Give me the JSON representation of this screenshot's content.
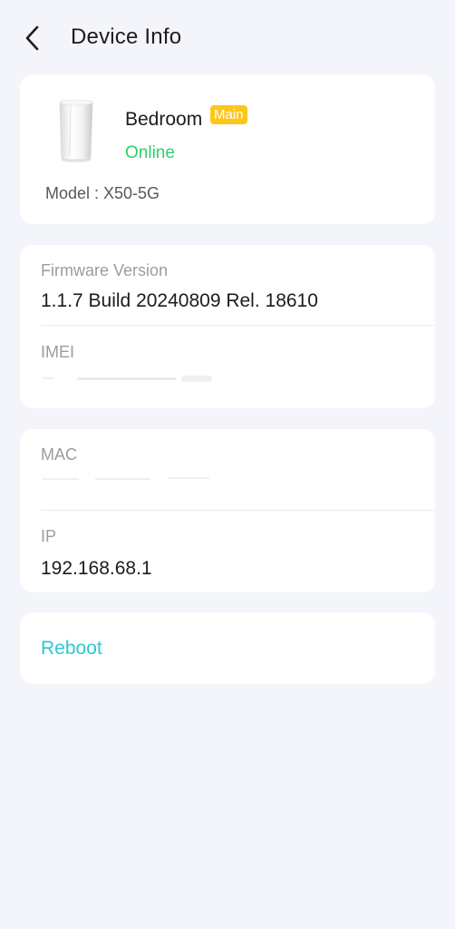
{
  "header": {
    "title": "Device Info",
    "back_icon": "chevron-left-icon"
  },
  "device": {
    "name": "Bedroom",
    "badge": "Main",
    "status": "Online",
    "model": "Model : X50-5G",
    "image": "router-device-image"
  },
  "details": {
    "firmware_label": "Firmware Version",
    "firmware_value": "1.1.7 Build 20240809 Rel. 18610",
    "imei_label": "IMEI",
    "mac_label": "MAC",
    "ip_label": "IP",
    "ip_value": "192.168.68.1"
  },
  "actions": {
    "reboot_label": "Reboot"
  },
  "colors": {
    "background": "#f4f5fa",
    "online": "#2fd06a",
    "badge": "#ffc61a",
    "accent": "#2ec7d3"
  }
}
